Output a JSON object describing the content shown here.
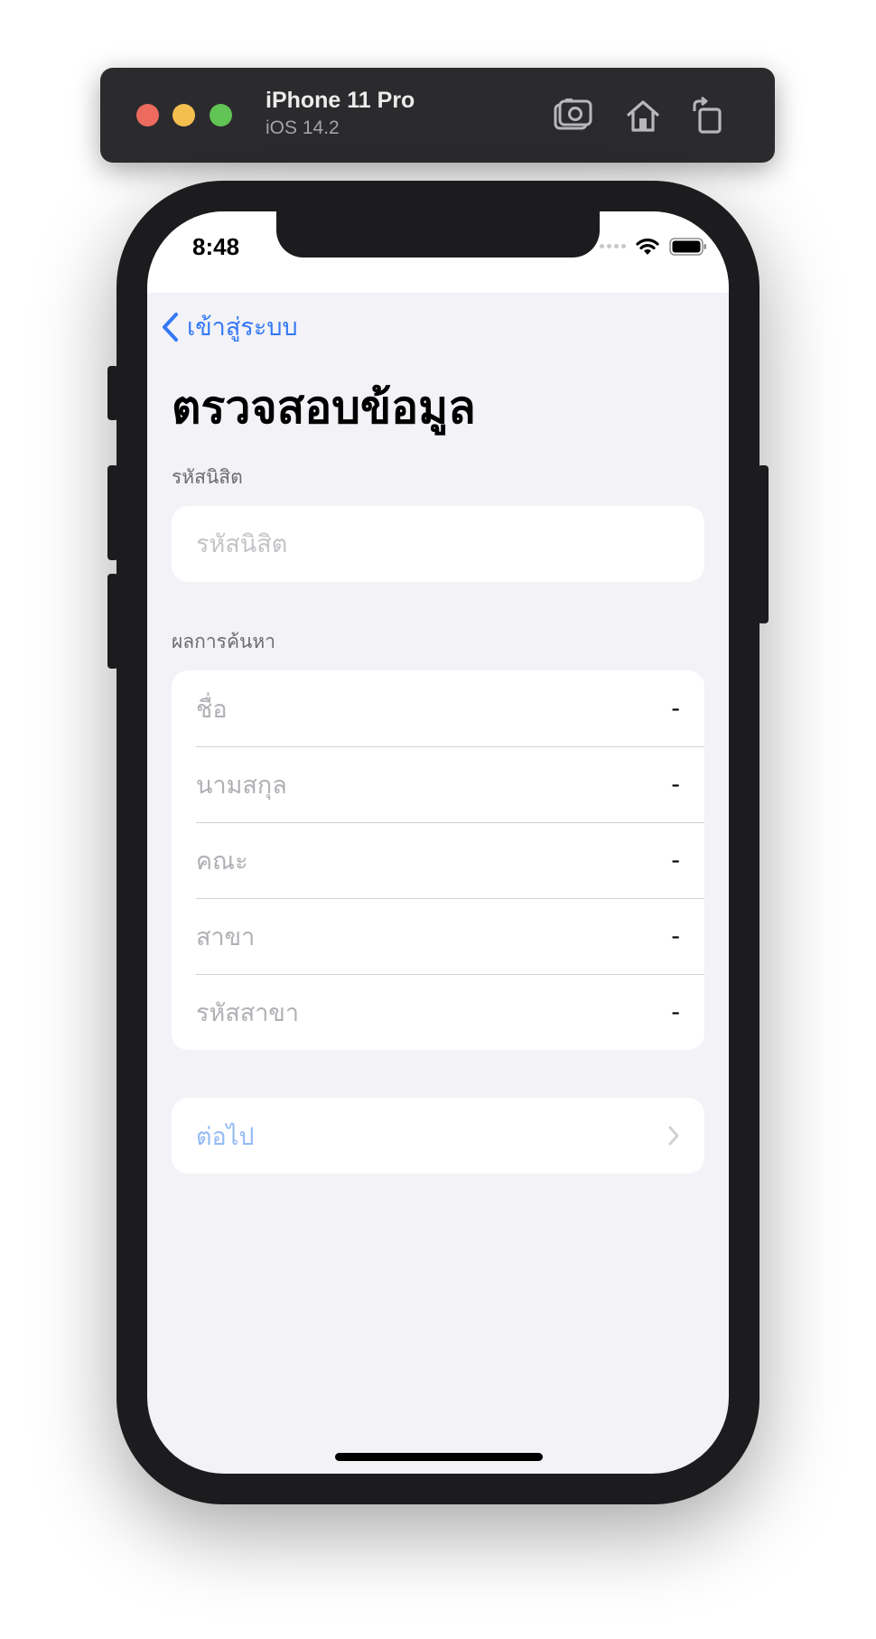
{
  "simulator": {
    "device_name": "iPhone 11 Pro",
    "os_version": "iOS 14.2",
    "buttons": [
      "screenshot-icon",
      "home-icon",
      "rotate-icon"
    ]
  },
  "status_bar": {
    "time": "8:48",
    "icons": [
      "cellular-icon",
      "wifi-icon",
      "battery-icon"
    ]
  },
  "nav": {
    "back_label": "เข้าสู่ระบบ",
    "title": "ตรวจสอบข้อมูล"
  },
  "student_id_section": {
    "header": "รหัสนิสิต",
    "placeholder": "รหัสนิสิต",
    "value": ""
  },
  "results_section": {
    "header": "ผลการค้นหา",
    "rows": [
      {
        "label": "ชื่อ",
        "value": "-"
      },
      {
        "label": "นามสกุล",
        "value": "-"
      },
      {
        "label": "คณะ",
        "value": "-"
      },
      {
        "label": "สาขา",
        "value": "-"
      },
      {
        "label": "รหัสสาขา",
        "value": "-"
      }
    ]
  },
  "next_button": {
    "label": "ต่อไป",
    "enabled": false
  },
  "colors": {
    "accent": "#3478f6",
    "accent_disabled": "#94bbf5",
    "background": "#f2f2f7",
    "card": "#ffffff",
    "secondary_text": "#b0b0b5"
  }
}
